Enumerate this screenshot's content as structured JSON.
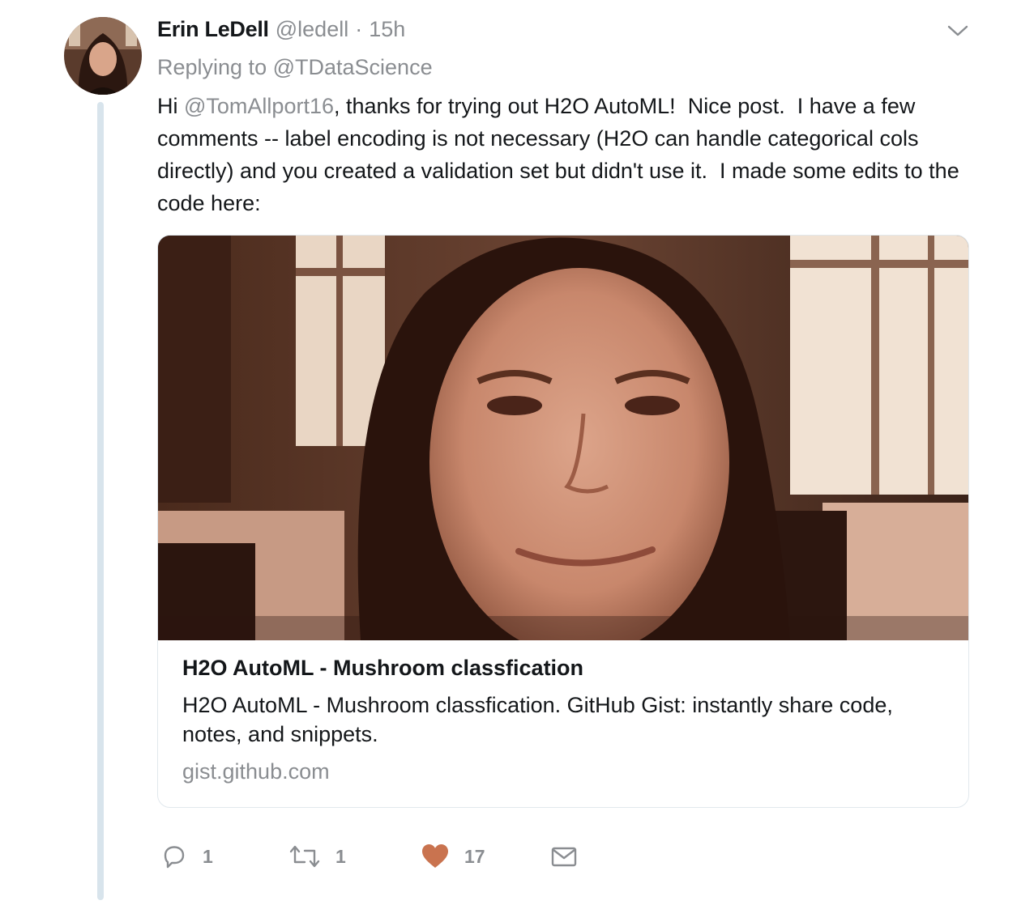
{
  "tweet": {
    "display_name": "Erin LeDell",
    "handle": "@ledell",
    "separator": "·",
    "time": "15h",
    "reply_prefix": "Replying to ",
    "reply_target": "@TDataScience",
    "text_hi": "Hi ",
    "text_mention": "@TomAllport16",
    "text_body": ", thanks for trying out H2O AutoML!  Nice post.  I have a few comments -- label encoding is not necessary (H2O can handle categorical cols directly) and you created a validation set but didn't use it.  I made some edits to the code here:"
  },
  "icons": {
    "avatar": "avatar-photo",
    "menu": "chevron-down-icon",
    "reply": "reply-icon",
    "retweet": "retweet-icon",
    "like": "heart-icon",
    "dm": "envelope-icon"
  },
  "card": {
    "title": "H2O AutoML - Mushroom classfication",
    "description": "H2O AutoML - Mushroom classfication. GitHub Gist: instantly share code, notes, and snippets.",
    "domain": "gist.github.com"
  },
  "actions": {
    "reply_count": "1",
    "retweet_count": "1",
    "like_count": "17"
  },
  "colors": {
    "text": "#14171a",
    "secondary": "#8a8d91",
    "like": "#e0245e",
    "thread_line": "#d8e4ec",
    "card_border": "#e1e8ed"
  }
}
